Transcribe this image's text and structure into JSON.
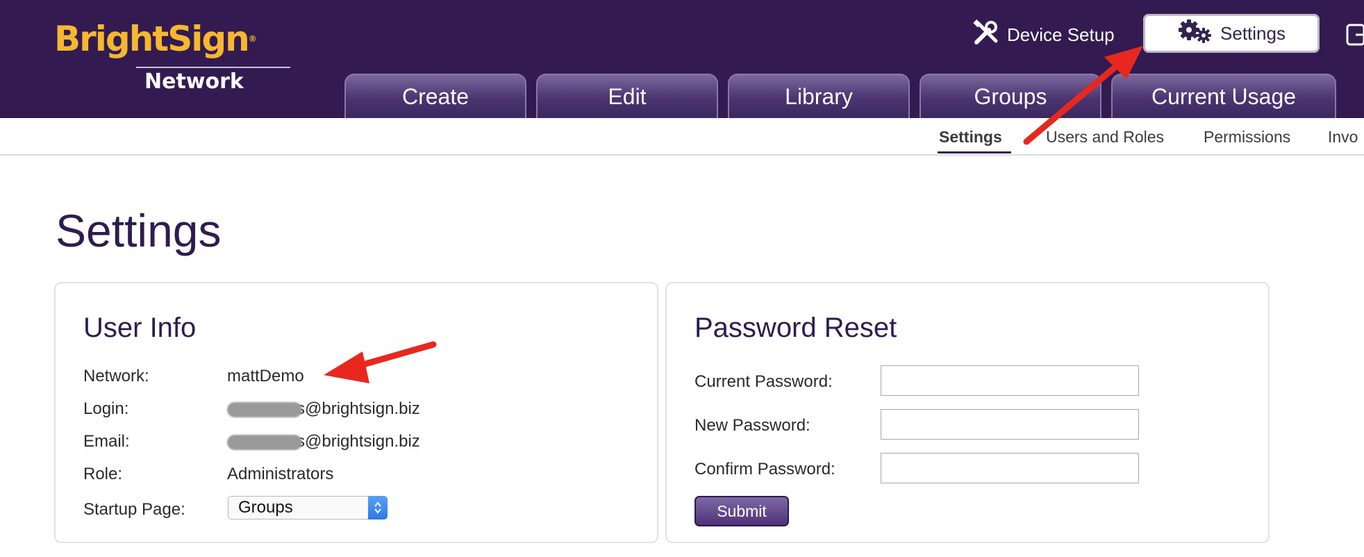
{
  "brand": {
    "logo_main": "BrightSign",
    "logo_sub": "Network",
    "registered": "®"
  },
  "utility": {
    "device_setup_label": "Device Setup",
    "settings_label": "Settings"
  },
  "tabs": [
    {
      "label": "Create"
    },
    {
      "label": "Edit"
    },
    {
      "label": "Library"
    },
    {
      "label": "Groups"
    },
    {
      "label": "Current Usage"
    }
  ],
  "subnav": {
    "items": [
      {
        "label": "Settings",
        "active": true
      },
      {
        "label": "Users and Roles"
      },
      {
        "label": "Permissions"
      },
      {
        "label": "Invo"
      }
    ]
  },
  "page": {
    "title": "Settings"
  },
  "user_info": {
    "title": "User Info",
    "network": {
      "label": "Network:",
      "value": "mattDemo"
    },
    "login": {
      "label": "Login:",
      "value": "s@brightsign.biz"
    },
    "email": {
      "label": "Email:",
      "value": "s@brightsign.biz"
    },
    "role": {
      "label": "Role:",
      "value": "Administrators"
    },
    "startup": {
      "label": "Startup Page:",
      "value": "Groups"
    }
  },
  "password_reset": {
    "title": "Password Reset",
    "current_label": "Current Password:",
    "new_label": "New Password:",
    "confirm_label": "Confirm Password:",
    "submit_label": "Submit"
  },
  "colors": {
    "header_bg": "#331b52",
    "brand_yellow": "#f5b82e",
    "title_purple": "#2e1c4f",
    "annotation_red": "#e8281e"
  }
}
